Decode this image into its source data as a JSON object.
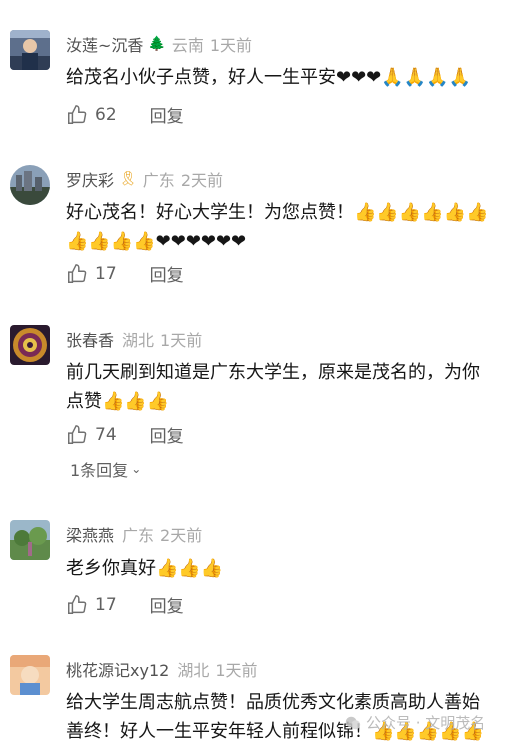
{
  "comments": [
    {
      "name": "汝莲~沉香",
      "badge": "🌲",
      "location": "云南",
      "time": "1天前",
      "text": "给茂名小伙子点赞，好人一生平安",
      "emoji_tail": "❤❤❤🙏🙏🙏🙏",
      "likes": "62",
      "reply_label": "回复"
    },
    {
      "name": "罗庆彩",
      "badge": "🎗",
      "location": "广东",
      "time": "2天前",
      "text": "好心茂名！好心大学生！为您点赞！",
      "emoji_tail": "👍👍👍👍👍👍👍👍👍👍❤❤❤❤❤❤",
      "likes": "17",
      "reply_label": "回复"
    },
    {
      "name": "张春香",
      "location": "湖北",
      "time": "1天前",
      "text": "前几天刷到知道是广东大学生，原来是茂名的，为你点赞",
      "emoji_tail": "👍👍👍",
      "likes": "74",
      "reply_label": "回复",
      "more_replies": "1条回复"
    },
    {
      "name": "梁燕燕",
      "location": "广东",
      "time": "2天前",
      "text": "老乡你真好",
      "emoji_tail": "👍👍👍",
      "likes": "17",
      "reply_label": "回复"
    },
    {
      "name": "桃花源记xy12",
      "location": "湖北",
      "time": "1天前",
      "text": "给大学生周志航点赞！品质优秀文化素质高助人善始善终！好人一生平安年轻人前程似锦！",
      "emoji_tail": "👍👍👍👍👍"
    }
  ],
  "watermark": "公众号 · 文明茂名"
}
